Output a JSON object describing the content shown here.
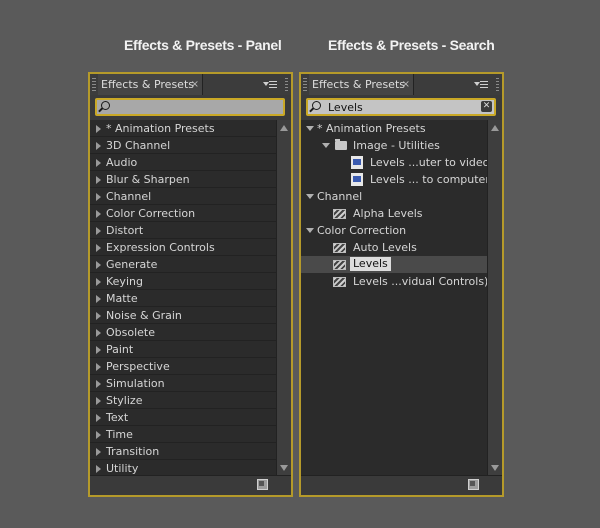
{
  "captions": {
    "left": "Effects & Presets - Panel",
    "right": "Effects & Presets - Search"
  },
  "left_panel": {
    "tab_title": "Effects & Presets",
    "tab_close": "×",
    "search_value": "",
    "items": [
      "* Animation Presets",
      "3D Channel",
      "Audio",
      "Blur & Sharpen",
      "Channel",
      "Color Correction",
      "Distort",
      "Expression Controls",
      "Generate",
      "Keying",
      "Matte",
      "Noise & Grain",
      "Obsolete",
      "Paint",
      "Perspective",
      "Simulation",
      "Stylize",
      "Text",
      "Time",
      "Transition",
      "Utility"
    ]
  },
  "right_panel": {
    "tab_title": "Effects & Presets",
    "tab_close": "×",
    "search_value": "Levels",
    "clear_label": "✕",
    "groups": {
      "animation_presets": "* Animation Presets",
      "image_utilities": "Image - Utilities",
      "preset_1": "Levels ...uter to video",
      "preset_2": "Levels ... to computer",
      "channel": "Channel",
      "alpha_levels": "Alpha Levels",
      "color_correction": "Color Correction",
      "auto_levels": "Auto Levels",
      "levels": "Levels",
      "levels_individual": "Levels ...vidual Controls)"
    }
  }
}
